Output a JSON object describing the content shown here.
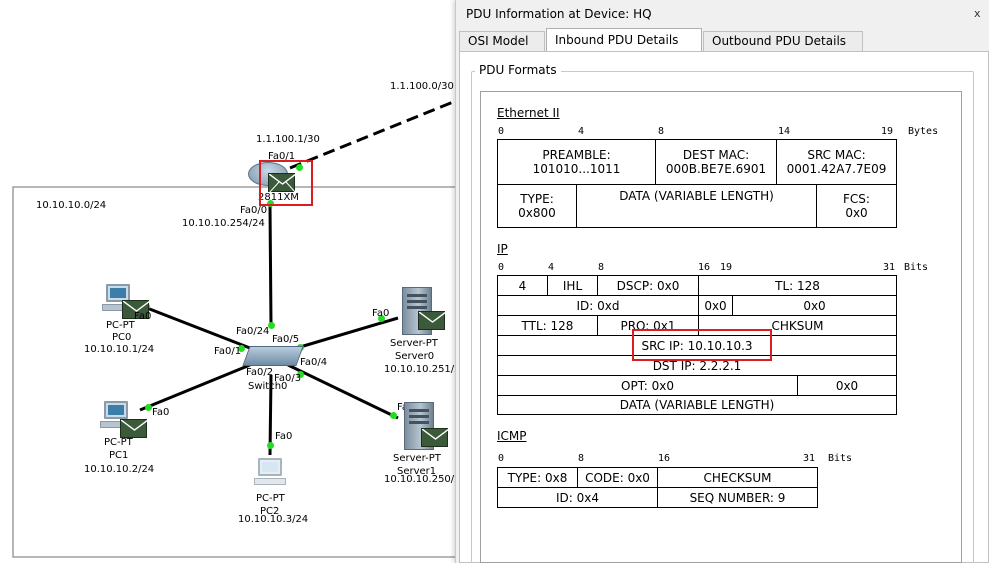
{
  "topology": {
    "wan_subnet": "1.1.100.0/30",
    "router": {
      "name": "2811XM",
      "wan_ip": "1.1.100.1/30",
      "wan_port": "Fa0/1",
      "lan_port": "Fa0/0",
      "lan_ip": "10.10.10.254/24"
    },
    "lan_subnet": "10.10.10.0/24",
    "switch": {
      "name": "Switch0",
      "model": "2950-24",
      "ports": [
        "Fa0/24",
        "Fa0/1",
        "Fa0/5",
        "Fa0/4",
        "Fa0/3",
        "Fa0/2"
      ]
    },
    "pcs": [
      {
        "type": "PC-PT",
        "name": "PC0",
        "ip": "10.10.10.1/24",
        "port": "Fa0"
      },
      {
        "type": "PC-PT",
        "name": "PC1",
        "ip": "10.10.10.2/24",
        "port": "Fa0"
      },
      {
        "type": "PC-PT",
        "name": "PC2",
        "ip": "10.10.10.3/24",
        "port": "Fa0"
      }
    ],
    "servers": [
      {
        "type": "Server-PT",
        "name": "Server0",
        "ip": "10.10.10.251/2",
        "port": "Fa0"
      },
      {
        "type": "Server-PT",
        "name": "Server1",
        "ip": "10.10.10.250/2",
        "port": "Fa0"
      }
    ]
  },
  "pdu_window": {
    "title": "PDU Information at Device: HQ",
    "close_glyph": "x",
    "tabs": [
      "OSI Model",
      "Inbound PDU Details",
      "Outbound PDU Details"
    ],
    "active_tab": "Inbound PDU Details",
    "group_label": "PDU Formats",
    "ethernet": {
      "title": "Ethernet II",
      "bit_marks": [
        "0",
        "4",
        "8",
        "14",
        "19",
        "Bytes"
      ],
      "row1": [
        {
          "label": "PREAMBLE:",
          "value": "101010...1011"
        },
        {
          "label": "DEST MAC:",
          "value": "000B.BE7E.6901"
        },
        {
          "label": "SRC MAC:",
          "value": "0001.42A7.7E09"
        }
      ],
      "row2": [
        {
          "label": "TYPE:",
          "value": "0x800"
        },
        {
          "label": "DATA (VARIABLE LENGTH)",
          "value": ""
        },
        {
          "label": "FCS:",
          "value": "0x0"
        }
      ]
    },
    "ip": {
      "title": "IP",
      "bit_marks": [
        "0",
        "4",
        "8",
        "16",
        "19",
        "31",
        "Bits"
      ],
      "version": "4",
      "ihl": "IHL",
      "dscp": "DSCP: 0x0",
      "tl": "TL: 128",
      "id": "ID: 0xd",
      "flags": "0x0",
      "frag": "0x0",
      "ttl": "TTL: 128",
      "proto": "PRO: 0x1",
      "chksum": "CHKSUM",
      "src_ip": "SRC IP: 10.10.10.3",
      "dst_ip": "DST IP: 2.2.2.1",
      "opt": "OPT: 0x0",
      "opt_pad": "0x0",
      "data": "DATA (VARIABLE LENGTH)"
    },
    "icmp": {
      "title": "ICMP",
      "bit_marks": [
        "0",
        "8",
        "16",
        "31",
        "Bits"
      ],
      "type": "TYPE: 0x8",
      "code": "CODE: 0x0",
      "checksum": "CHECKSUM",
      "id": "ID: 0x4",
      "seq": "SEQ NUMBER: 9"
    }
  },
  "colors": {
    "highlight": "#d81e1e",
    "link_up": "#22dd22",
    "envelope": "#3b5a3a"
  }
}
